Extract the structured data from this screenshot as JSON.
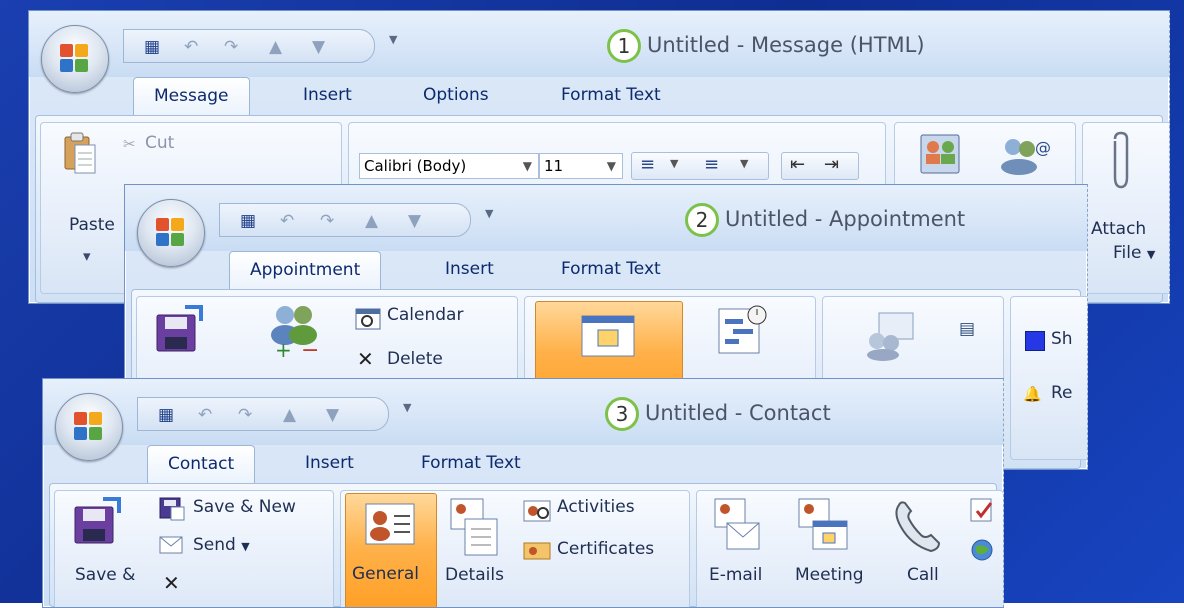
{
  "windows": {
    "message": {
      "number": "1",
      "title": "Untitled - Message (HTML)",
      "tabs": [
        "Message",
        "Insert",
        "Options",
        "Format Text"
      ],
      "clipboard": {
        "paste": "Paste",
        "cut": "Cut"
      },
      "font": {
        "name": "Calibri (Body)",
        "size": "11"
      },
      "attach": {
        "line1": "Attach",
        "line2": "File"
      }
    },
    "appointment": {
      "number": "2",
      "title": "Untitled - Appointment",
      "tabs": [
        "Appointment",
        "Insert",
        "Format Text"
      ],
      "actions": {
        "calendar": "Calendar",
        "delete": "Delete"
      },
      "options": {
        "show_as_partial": "Sh",
        "reminder_partial": "Re"
      }
    },
    "contact": {
      "number": "3",
      "title": "Untitled - Contact",
      "tabs": [
        "Contact",
        "Insert",
        "Format Text"
      ],
      "actions": {
        "save_new": "Save & New",
        "send": "Send",
        "save_close_partial": "Save &"
      },
      "show": {
        "general": "General",
        "details": "Details",
        "activities": "Activities",
        "certificates": "Certificates"
      },
      "communicate": {
        "email": "E-mail",
        "meeting": "Meeting",
        "call": "Call"
      }
    }
  },
  "colors": {
    "background": "#1a3fb0",
    "active_tab": "#ffffff",
    "highlight": "#ffb14a",
    "number_ring": "#7cc24a"
  }
}
